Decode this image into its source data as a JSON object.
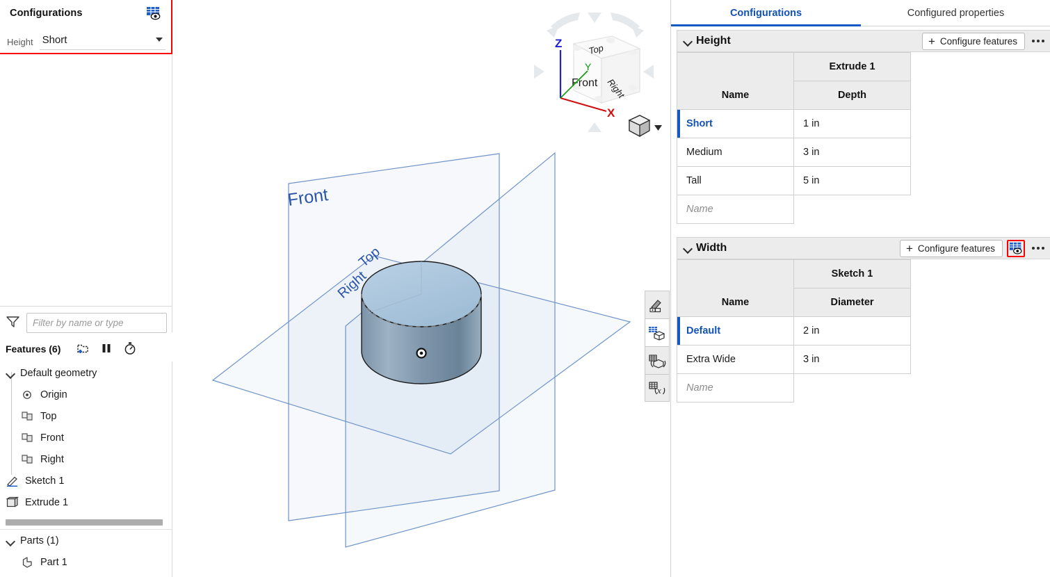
{
  "left_panel": {
    "config_box": {
      "title": "Configurations",
      "table_eye_icon": "configuration-table-eye-icon",
      "field_label": "Height",
      "field_value": "Short",
      "highlight_color": "#ff0000"
    },
    "filter": {
      "icon": "filter-funnel-icon",
      "placeholder": "Filter by name or type",
      "value": ""
    },
    "features": {
      "label": "Features (6)",
      "icons": [
        "add-folder-icon",
        "pause-icon",
        "stopwatch-icon"
      ],
      "tab_icon": "collapse-tree-icon",
      "items": [
        {
          "label": "Default geometry",
          "icon": "chevron-down-icon",
          "level": 1,
          "caret": true
        },
        {
          "label": "Origin",
          "icon": "origin-point-icon",
          "level": 2,
          "caret": false
        },
        {
          "label": "Top",
          "icon": "plane-icon",
          "level": 2,
          "caret": false
        },
        {
          "label": "Front",
          "icon": "plane-icon",
          "level": 2,
          "caret": false
        },
        {
          "label": "Right",
          "icon": "plane-icon",
          "level": 2,
          "caret": false
        },
        {
          "label": "Sketch 1",
          "icon": "sketch-icon",
          "level": 1,
          "caret": false
        },
        {
          "label": "Extrude 1",
          "icon": "extrude-icon",
          "level": 1,
          "caret": false
        }
      ]
    },
    "parts": {
      "label": "Parts (1)",
      "items": [
        {
          "label": "Part 1",
          "icon": "part-icon"
        }
      ]
    }
  },
  "viewport": {
    "planes": [
      {
        "label": "Front"
      },
      {
        "label": "Top"
      },
      {
        "label": "Right"
      }
    ],
    "viewcube": {
      "faces": [
        "Top",
        "Front",
        "Right"
      ],
      "axes": [
        {
          "label": "Z",
          "color": "#2020d0"
        },
        {
          "label": "Y",
          "color": "#0a9a0a"
        },
        {
          "label": "X",
          "color": "#d01010"
        }
      ],
      "view_mode_icon": "shaded-cube-icon",
      "view_mode_caret": "chevron-down-icon"
    },
    "model": {
      "shape": "cylinder",
      "origin_marker": "origin-point-icon"
    },
    "toolbar": [
      {
        "icon": "appearance-icon",
        "active": false
      },
      {
        "icon": "configurations-cube-icon",
        "active": true
      },
      {
        "icon": "variable-table-icon",
        "active": false
      },
      {
        "icon": "variable-studio-icon",
        "active": false
      }
    ]
  },
  "right_panel": {
    "tabs": [
      {
        "label": "Configurations",
        "active": true
      },
      {
        "label": "Configured properties",
        "active": false
      }
    ],
    "sections": [
      {
        "title": "Height",
        "caret": "chevron-down-icon",
        "configure_button": "Configure features",
        "has_table_eye": false,
        "table_eye_highlighted": false,
        "feature_header": "Extrude 1",
        "name_header": "Name",
        "param_header": "Depth",
        "rows": [
          {
            "name": "Short",
            "value": "1 in",
            "selected": true
          },
          {
            "name": "Medium",
            "value": "3 in",
            "selected": false
          },
          {
            "name": "Tall",
            "value": "5 in",
            "selected": false
          }
        ],
        "new_row_placeholder": "Name"
      },
      {
        "title": "Width",
        "caret": "chevron-down-icon",
        "configure_button": "Configure features",
        "has_table_eye": true,
        "table_eye_highlighted": true,
        "feature_header": "Sketch 1",
        "name_header": "Name",
        "param_header": "Diameter",
        "rows": [
          {
            "name": "Default",
            "value": "2 in",
            "selected": true
          },
          {
            "name": "Extra Wide",
            "value": "3 in",
            "selected": false
          }
        ],
        "new_row_placeholder": "Name"
      }
    ]
  },
  "colors": {
    "accent_blue": "#1252b3",
    "highlight_red": "#ff0000",
    "header_gray": "#ececec",
    "plane_blue": "#5580c0"
  }
}
